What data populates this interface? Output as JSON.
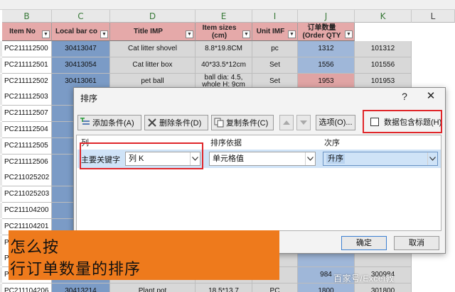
{
  "sheet": {
    "col_letters": [
      "B",
      "C",
      "D",
      "E",
      "I",
      "J",
      "K",
      "L"
    ],
    "headers": {
      "item_no": "Item No",
      "local_bar": "Local bar co",
      "title": "Title IMP",
      "sizes": "Item sizes\n(cm)",
      "unit": "Unit IMF",
      "qty": "订单数量\n(Order QTY"
    },
    "rows": [
      {
        "b": "PC211112500",
        "c": "30413047",
        "d": "Cat litter shovel",
        "e": "8.8*19.8CM",
        "i": "pc",
        "j": "1312",
        "k": "101312"
      },
      {
        "b": "PC211112501",
        "c": "30413054",
        "d": "Cat litter box",
        "e": "40*33.5*12cm",
        "i": "Set",
        "j": "1556",
        "k": "101556"
      },
      {
        "b": "PC211112502",
        "c": "30413061",
        "d": "pet ball",
        "e": "ball dia: 4.5,\nwhole H: 9cm",
        "i": "Set",
        "j": "1953",
        "k": "101953"
      },
      {
        "b": "PC211112503",
        "c": "",
        "d": "",
        "e": "",
        "i": "",
        "j": "",
        "k": ""
      },
      {
        "b": "PC211112507",
        "c": "",
        "d": "",
        "e": "",
        "i": "",
        "j": "",
        "k": ""
      },
      {
        "b": "PC211112504",
        "c": "",
        "d": "",
        "e": "",
        "i": "",
        "j": "",
        "k": ""
      },
      {
        "b": "PC211112505",
        "c": "",
        "d": "",
        "e": "",
        "i": "",
        "j": "",
        "k": ""
      },
      {
        "b": "PC211112506",
        "c": "",
        "d": "",
        "e": "",
        "i": "",
        "j": "",
        "k": ""
      },
      {
        "b": "PC211025202",
        "c": "",
        "d": "",
        "e": "",
        "i": "",
        "j": "",
        "k": ""
      },
      {
        "b": "PC211025203",
        "c": "",
        "d": "",
        "e": "",
        "i": "",
        "j": "",
        "k": ""
      },
      {
        "b": "PC211104200",
        "c": "",
        "d": "",
        "e": "",
        "i": "",
        "j": "",
        "k": ""
      },
      {
        "b": "PC211104201",
        "c": "",
        "d": "",
        "e": "",
        "i": "",
        "j": "",
        "k": ""
      },
      {
        "b": "PC",
        "c": "",
        "d": "",
        "e": "",
        "i": "",
        "j": "",
        "k": ""
      },
      {
        "b": "PC",
        "c": "",
        "d": "",
        "e": "",
        "i": "",
        "j": "",
        "k": ""
      },
      {
        "b": "PC",
        "c": "",
        "d": "",
        "e": "",
        "i": "",
        "j": "984",
        "k": "300984"
      },
      {
        "b": "PC211104206",
        "c": "30413214",
        "d": "Plant pot",
        "e": "18.5*13.7",
        "i": "PC",
        "j": "1800",
        "k": "301800"
      }
    ]
  },
  "dialog": {
    "title": "排序",
    "help": "?",
    "close": "✕",
    "add_level": "添加条件(A)",
    "delete_level": "删除条件(D)",
    "copy_level": "复制条件(C)",
    "options": "选项(O)...",
    "header_checkbox": "数据包含标题(H)",
    "grid_headers": {
      "column": "列",
      "sort_on": "排序依据",
      "order": "次序"
    },
    "row": {
      "label": "主要关键字",
      "column_value": "列 K",
      "sort_on_value": "单元格值",
      "order_value": "升序"
    },
    "ok": "确定",
    "cancel": "取消"
  },
  "overlay": {
    "caption_line1": "怎么按",
    "caption_line2": "行订单数量的排序",
    "watermark": "百家号/Excel教"
  },
  "colors": {
    "accent_red": "#e0262a",
    "caption_orange": "#ee7a1c",
    "header_pink": "#e5a9a9",
    "col_c_blue": "#7b9bc6",
    "col_j_blue": "#9fb7d9",
    "selection_blue": "#cfe3f7"
  }
}
